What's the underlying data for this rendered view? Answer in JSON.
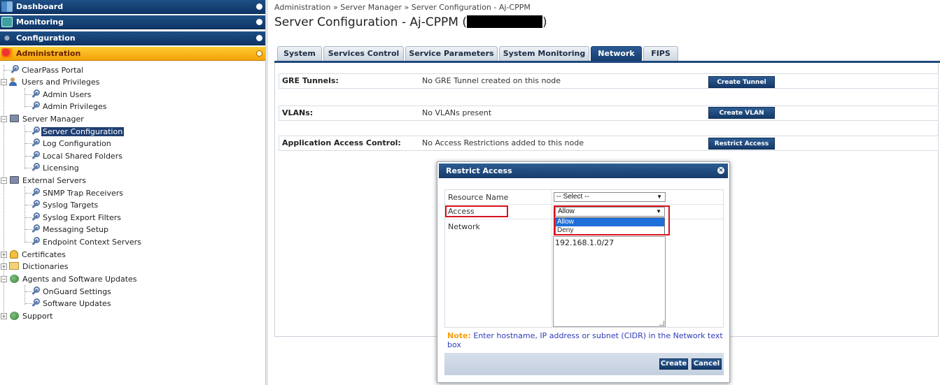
{
  "sidebar": {
    "headers": [
      {
        "label": "Dashboard"
      },
      {
        "label": "Monitoring"
      },
      {
        "label": "Configuration"
      },
      {
        "label": "Administration"
      }
    ],
    "tree": [
      {
        "label": "ClearPass Portal"
      },
      {
        "label": "Users and Privileges",
        "toggle": "−"
      },
      {
        "label": "Admin Users"
      },
      {
        "label": "Admin Privileges"
      },
      {
        "label": "Server Manager",
        "toggle": "−"
      },
      {
        "label": "Server Configuration"
      },
      {
        "label": "Log Configuration"
      },
      {
        "label": "Local Shared Folders"
      },
      {
        "label": "Licensing"
      },
      {
        "label": "External Servers",
        "toggle": "−"
      },
      {
        "label": "SNMP Trap Receivers"
      },
      {
        "label": "Syslog Targets"
      },
      {
        "label": "Syslog Export Filters"
      },
      {
        "label": "Messaging Setup"
      },
      {
        "label": "Endpoint Context Servers"
      },
      {
        "label": "Certificates",
        "toggle": "+"
      },
      {
        "label": "Dictionaries",
        "toggle": "+"
      },
      {
        "label": "Agents and Software Updates",
        "toggle": "−"
      },
      {
        "label": "OnGuard Settings"
      },
      {
        "label": "Software Updates"
      },
      {
        "label": "Support",
        "toggle": "+"
      }
    ]
  },
  "main": {
    "breadcrumb": "Administration » Server Manager » Server Configuration - Aj-CPPM",
    "title_prefix": "Server Configuration - Aj-CPPM (",
    "title_suffix": ")",
    "tabs": [
      {
        "label": "System"
      },
      {
        "label": "Services Control"
      },
      {
        "label": "Service Parameters"
      },
      {
        "label": "System Monitoring"
      },
      {
        "label": "Network"
      },
      {
        "label": "FIPS"
      }
    ],
    "sections": [
      {
        "label": "GRE Tunnels:",
        "value": "No GRE Tunnel created on this node",
        "button": "Create Tunnel"
      },
      {
        "label": "VLANs:",
        "value": "No VLANs present",
        "button": "Create VLAN"
      },
      {
        "label": "Application Access Control:",
        "value": "No Access Restrictions added to this node",
        "button": "Restrict Access"
      }
    ]
  },
  "dialog": {
    "title": "Restrict Access",
    "close_glyph": "×",
    "fields": {
      "resource_name_label": "Resource Name",
      "resource_name_value": "-- Select --",
      "access_label": "Access",
      "access_value": "Allow",
      "access_options": [
        "Allow",
        "Deny"
      ],
      "network_label": "Network",
      "network_value": "192.168.1.0/27"
    },
    "note_label": "Note:",
    "note_text": " Enter hostname, IP address or subnet (CIDR) in the Network text box",
    "create_button": "Create",
    "cancel_button": "Cancel",
    "dropdown_arrow": "▼"
  },
  "colors": {
    "nav_dark": "#0e3566",
    "nav_active": "#f1a309",
    "tab_active": "#173e70",
    "highlight_red": "#d8131d",
    "note_label": "#f5a00f",
    "note_text": "#2e3bb8"
  }
}
